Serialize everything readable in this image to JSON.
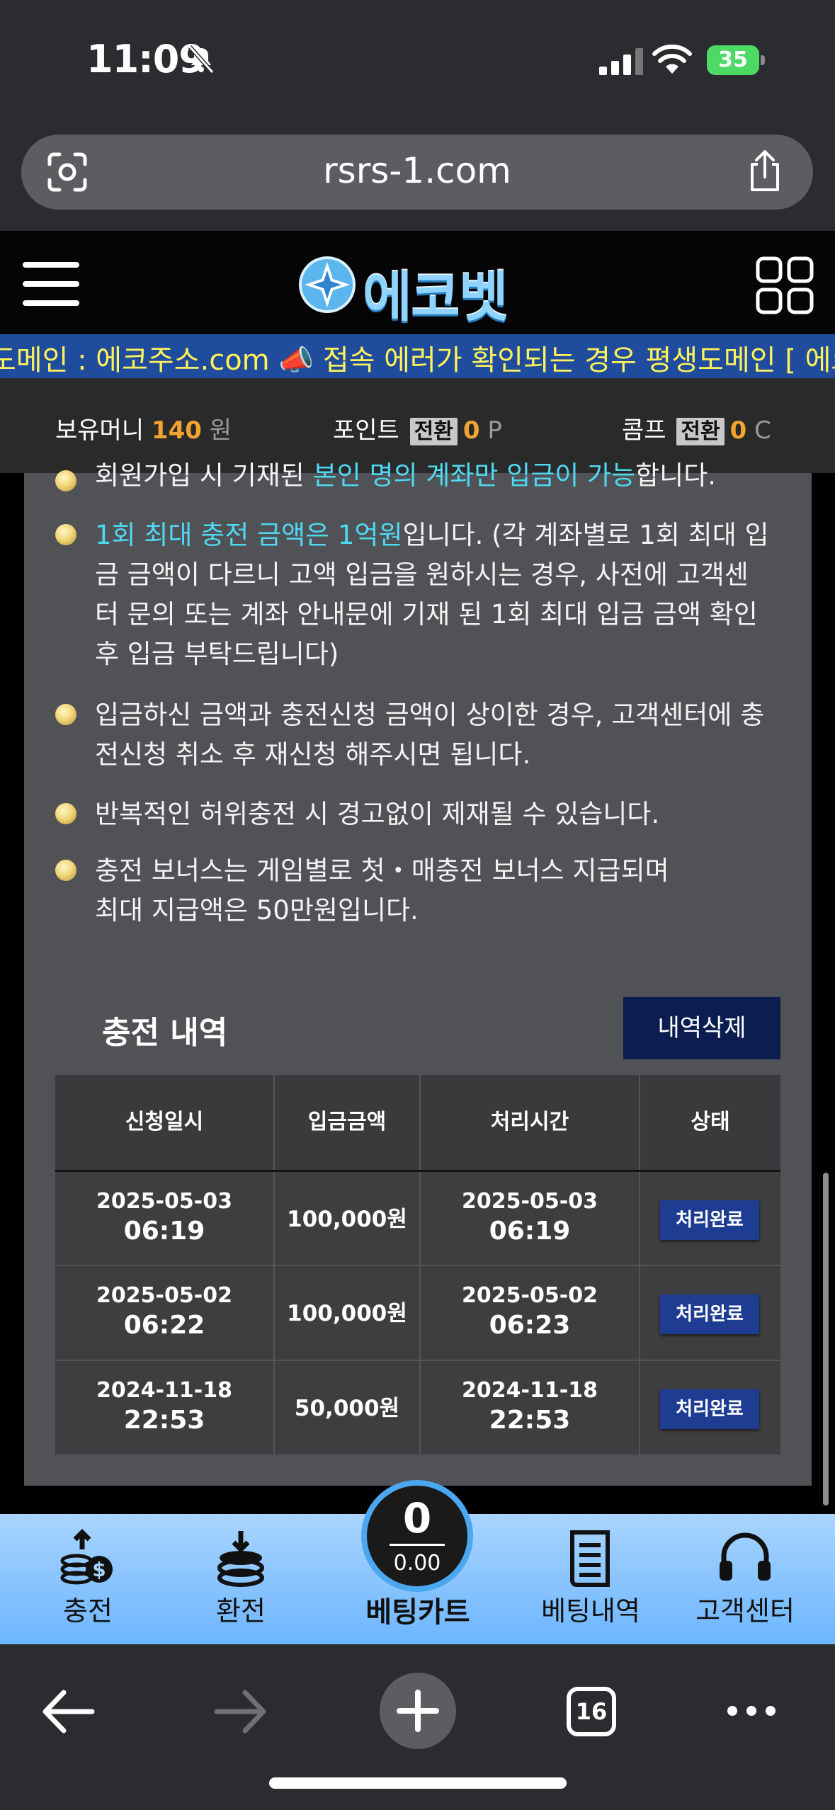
{
  "status_bar": {
    "time": "11:09",
    "battery": "35"
  },
  "browser": {
    "url": "rsrs-1.com",
    "tab_count": "16"
  },
  "site": {
    "logo_text": "에코벳",
    "marquee": "도메인 : 에코주소.com 📣 접속 에러가 확인되는 경우 평생도메인 [ 에코주"
  },
  "money_bar": {
    "money_label": "보유머니",
    "money_value": "140",
    "money_unit": "원",
    "point_label": "포인트",
    "point_button": "전환",
    "point_value": "0",
    "point_unit": "P",
    "comp_label": "콤프",
    "comp_button": "전환",
    "comp_value": "0",
    "comp_unit": "C"
  },
  "notices": {
    "item0_prefix": "회원가입 시 기재된 ",
    "item0_highlight": "본인 명의 계좌만 입금이 가능",
    "item0_suffix": "합니다.",
    "item1_highlight": "1회 최대 충전 금액은 1억원",
    "item1_line1_rest": "입니다. (각 계좌별로 1회 최대 입",
    "item1_line2": "금 금액이 다르니 고액 입금을 원하시는 경우, 사전에 고객센",
    "item1_line3": "터 문의 또는 계좌 안내문에 기재 된 1회 최대 입금 금액 확인",
    "item1_line4": "후 입금 부탁드립니다)",
    "item2_line1": "입금하신 금액과 충전신청 금액이 상이한 경우, 고객센터에 충",
    "item2_line2": "전신청 취소 후 재신청 해주시면 됩니다.",
    "item3": "반복적인 허위충전 시 경고없이 제재될 수 있습니다.",
    "item4_line1": "충전 보너스는 게임별로 첫・매충전 보너스 지급되며",
    "item4_line2": "최대 지급액은 50만원입니다."
  },
  "history": {
    "title": "충전 내역",
    "delete_button": "내역삭제",
    "columns": [
      "신청일시",
      "입금금액",
      "처리시간",
      "상태"
    ],
    "rows": [
      {
        "req_date": "2025-05-03",
        "req_time": "06:19",
        "amount": "100,000원",
        "proc_date": "2025-05-03",
        "proc_time": "06:19",
        "status": "처리완료"
      },
      {
        "req_date": "2025-05-02",
        "req_time": "06:22",
        "amount": "100,000원",
        "proc_date": "2025-05-02",
        "proc_time": "06:23",
        "status": "처리완료"
      },
      {
        "req_date": "2024-11-18",
        "req_time": "22:53",
        "amount": "50,000원",
        "proc_date": "2024-11-18",
        "proc_time": "22:53",
        "status": "처리완료"
      }
    ]
  },
  "bottom_nav": {
    "charge": "충전",
    "withdraw": "환전",
    "cart_label": "베팅카트",
    "cart_count": "0",
    "cart_amount": "0.00",
    "bet_history": "베팅내역",
    "support": "고객센터"
  },
  "colors": {
    "accent_cyan": "#4fd8f2",
    "accent_orange": "#f2a431",
    "marquee_bg": "#1f4c9d",
    "marquee_text": "#fff25a",
    "badge_blue": "#1e3c91",
    "nav_blue": "#6cb5ff"
  }
}
